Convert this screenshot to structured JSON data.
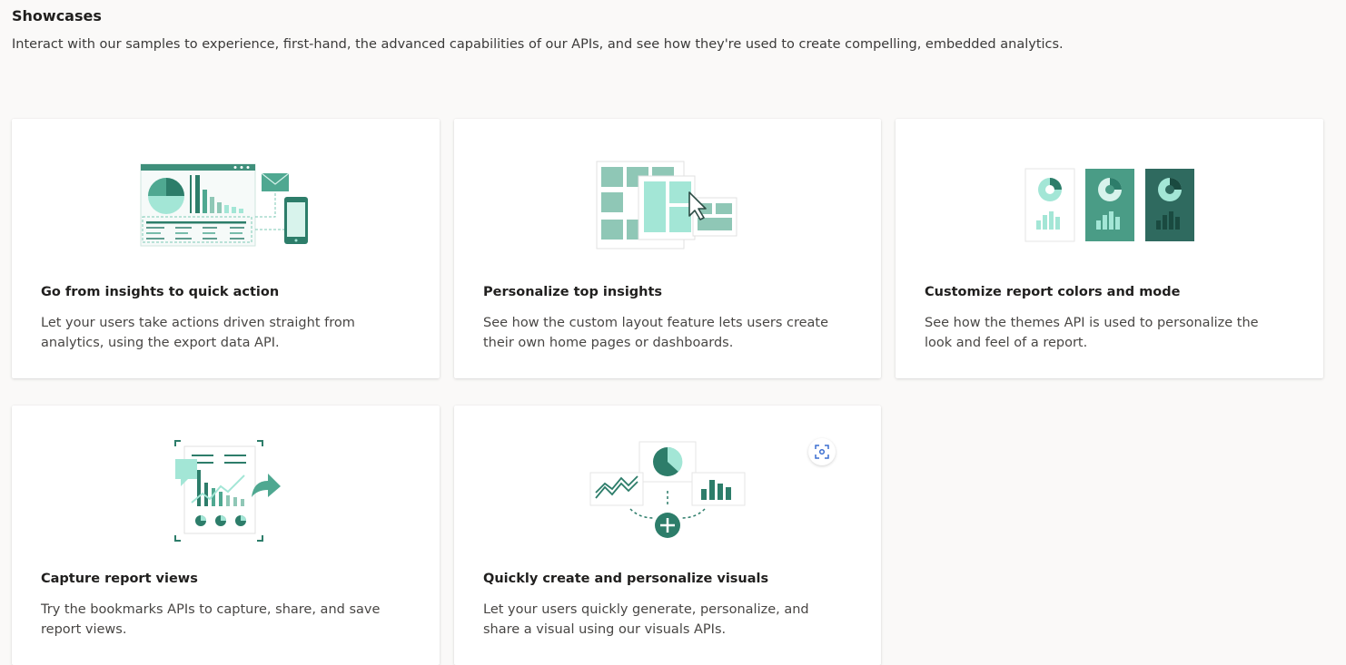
{
  "header": {
    "title": "Showcases",
    "subtitle": "Interact with our samples to experience, first-hand, the advanced capabilities of our APIs, and see how they're used to create compelling, embedded analytics."
  },
  "colors": {
    "accent_dark": "#2d7d6a",
    "accent_mid": "#4fa891",
    "accent_light": "#a3e6d6",
    "accent_muted": "#8fc7b6",
    "page_bg": "#faf9f8"
  },
  "cards": [
    {
      "title": "Go from insights to quick action",
      "description": "Let your users take actions driven straight from analytics, using the export data API.",
      "illustration": "dashboard-export-illustration"
    },
    {
      "title": "Personalize top insights",
      "description": "See how the custom layout feature lets users create their own home pages or dashboards.",
      "illustration": "custom-layout-illustration"
    },
    {
      "title": "Customize report colors and mode",
      "description": "See how the themes API is used to personalize the look and feel of a report.",
      "illustration": "themes-illustration"
    },
    {
      "title": "Capture report views",
      "description": "Try the bookmarks APIs to capture, share, and save report views.",
      "illustration": "bookmarks-illustration"
    },
    {
      "title": "Quickly create and personalize visuals",
      "description": "Let your users quickly generate, personalize, and share a visual using our visuals APIs.",
      "illustration": "visuals-illustration",
      "has_focus_button": true
    }
  ]
}
